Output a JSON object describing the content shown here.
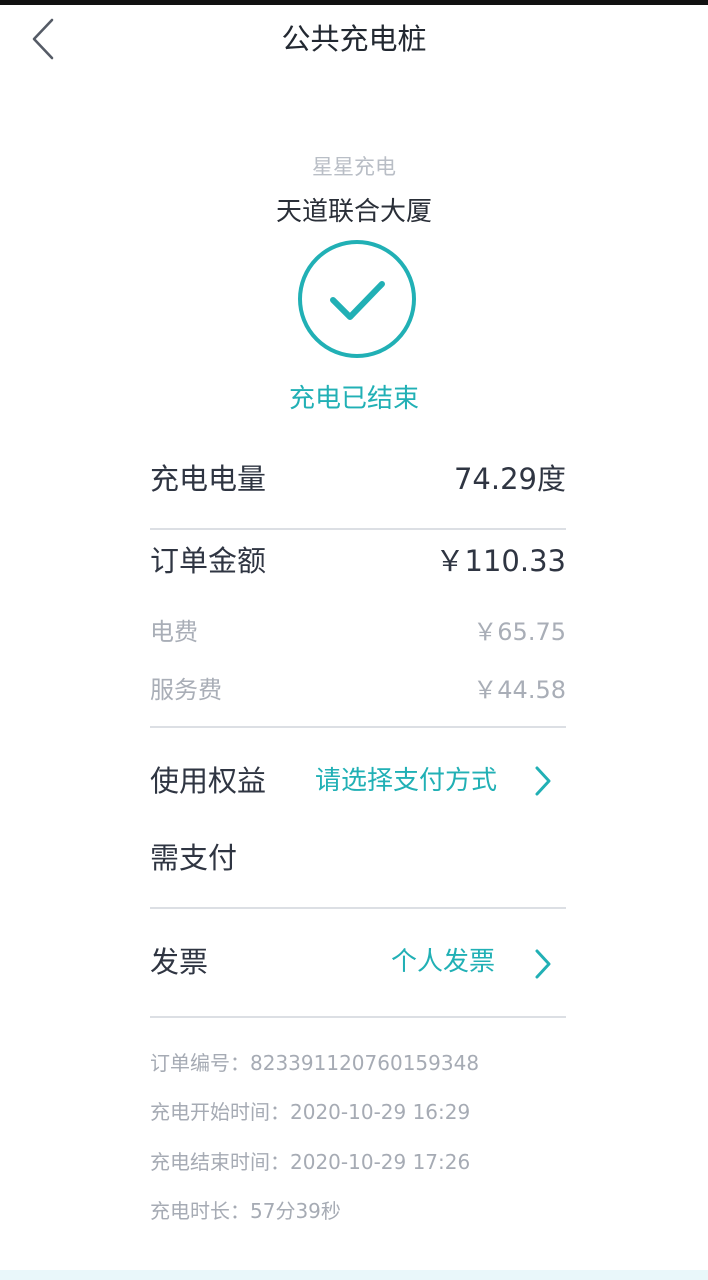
{
  "header": {
    "title": "公共充电桩",
    "back_icon": "chevron-left-icon"
  },
  "station": {
    "operator": "星星充电",
    "name": "天道联合大厦",
    "status_icon": "check-circle-icon",
    "status_text": "充电已结束"
  },
  "charge": {
    "energy_label": "充电电量",
    "energy_value": "74.29度"
  },
  "order": {
    "amount_label": "订单金额",
    "amount_value": "￥110.33",
    "electricity_label": "电费",
    "electricity_value": "￥65.75",
    "service_label": "服务费",
    "service_value": "￥44.58"
  },
  "benefits": {
    "label": "使用权益",
    "action": "请选择支付方式"
  },
  "payment": {
    "label": "需支付"
  },
  "invoice": {
    "label": "发票",
    "action": "个人发票"
  },
  "meta": {
    "order_no": "订单编号：823391120760159348",
    "start_time": "充电开始时间：2020-10-29  16:29",
    "end_time": "充电结束时间：2020-10-29  17:26",
    "duration": "充电时长：57分39秒"
  },
  "colors": {
    "accent": "#21b0b5",
    "text_primary": "#2f3542",
    "text_muted": "#a9aeb7",
    "divider": "#dcdfe4"
  }
}
